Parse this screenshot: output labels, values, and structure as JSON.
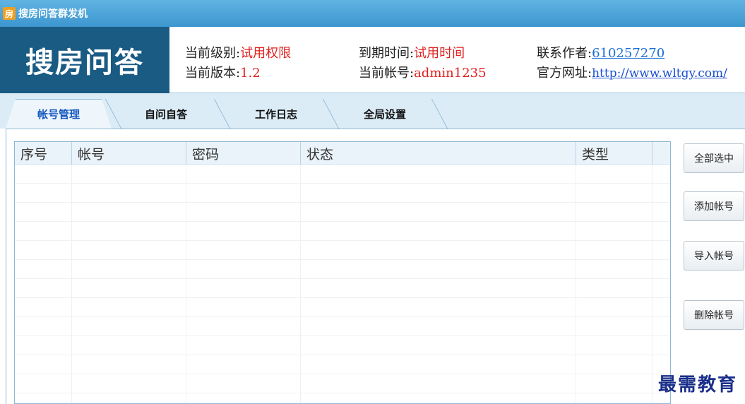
{
  "window": {
    "title": "搜房问答群发机",
    "icon": "房"
  },
  "header": {
    "brand": "搜房问答",
    "level_label": "当前级别:",
    "level_value": "试用权限",
    "version_label": "当前版本:",
    "version_value": "1.2",
    "expire_label": "到期时间:",
    "expire_value": "试用时间",
    "account_label": "当前帐号:",
    "account_value": "admin1235",
    "contact_label": "联系作者:",
    "contact_value": "610257270",
    "site_label": "官方网址:",
    "site_value": "http://www.wltgy.com/"
  },
  "tabs": [
    {
      "label": "帐号管理",
      "active": true
    },
    {
      "label": "自问自答",
      "active": false
    },
    {
      "label": "工作日志",
      "active": false
    },
    {
      "label": "全局设置",
      "active": false
    }
  ],
  "table": {
    "columns": [
      "序号",
      "帐号",
      "密码",
      "状态",
      "类型"
    ],
    "rows": []
  },
  "buttons": {
    "select_all": "全部选中",
    "add": "添加帐号",
    "import": "导入帐号",
    "delete": "删除帐号"
  },
  "watermark": "最需教育",
  "colors": {
    "brand_bg": "#1a5b84",
    "titlebar": "#3d96cf",
    "highlight_red": "#e02020",
    "link_blue": "#1a4fd0"
  }
}
